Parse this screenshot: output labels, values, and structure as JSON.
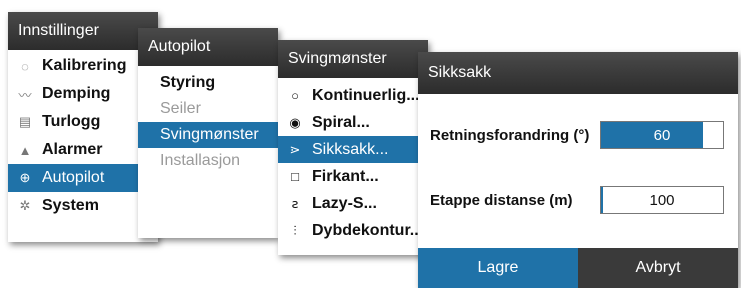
{
  "panels": {
    "innstillinger": {
      "title": "Innstillinger",
      "items": [
        {
          "label": "Kalibrering",
          "icon": "calibration-icon"
        },
        {
          "label": "Demping",
          "icon": "damping-icon"
        },
        {
          "label": "Turlogg",
          "icon": "trip-log-icon"
        },
        {
          "label": "Alarmer",
          "icon": "alarm-bell-icon"
        },
        {
          "label": "Autopilot",
          "icon": "steering-wheel-icon"
        },
        {
          "label": "System",
          "icon": "gear-icon"
        }
      ],
      "selected": "Autopilot"
    },
    "autopilot": {
      "title": "Autopilot",
      "items": [
        {
          "label": "Styring",
          "state": "enabled"
        },
        {
          "label": "Seiler",
          "state": "disabled"
        },
        {
          "label": "Svingmønster",
          "state": "selected"
        },
        {
          "label": "Installasjon",
          "state": "disabled"
        }
      ]
    },
    "svingmonster": {
      "title": "Svingmønster",
      "items": [
        {
          "label": "Kontinuerlig...",
          "icon": "circle-icon"
        },
        {
          "label": "Spiral...",
          "icon": "spiral-icon"
        },
        {
          "label": "Sikksakk...",
          "icon": "zigzag-icon"
        },
        {
          "label": "Firkant...",
          "icon": "square-icon"
        },
        {
          "label": "Lazy-S...",
          "icon": "lazy-s-icon"
        },
        {
          "label": "Dybdekontur...",
          "icon": "depth-contour-icon"
        }
      ],
      "selected": "Sikksakk..."
    },
    "sikksakk": {
      "title": "Sikksakk",
      "fields": [
        {
          "label": "Retningsforandring (°)",
          "value": "60",
          "fill_fraction": 0.84
        },
        {
          "label": "Etappe distanse (m)",
          "value": "100",
          "fill_fraction": 0.02
        }
      ],
      "buttons": {
        "save": "Lagre",
        "cancel": "Avbryt"
      }
    }
  },
  "colors": {
    "accent": "#1f72a8",
    "titlebar": "#333333",
    "disabled_text": "#9a9a9a",
    "cancel_button": "#3a3a3a"
  }
}
